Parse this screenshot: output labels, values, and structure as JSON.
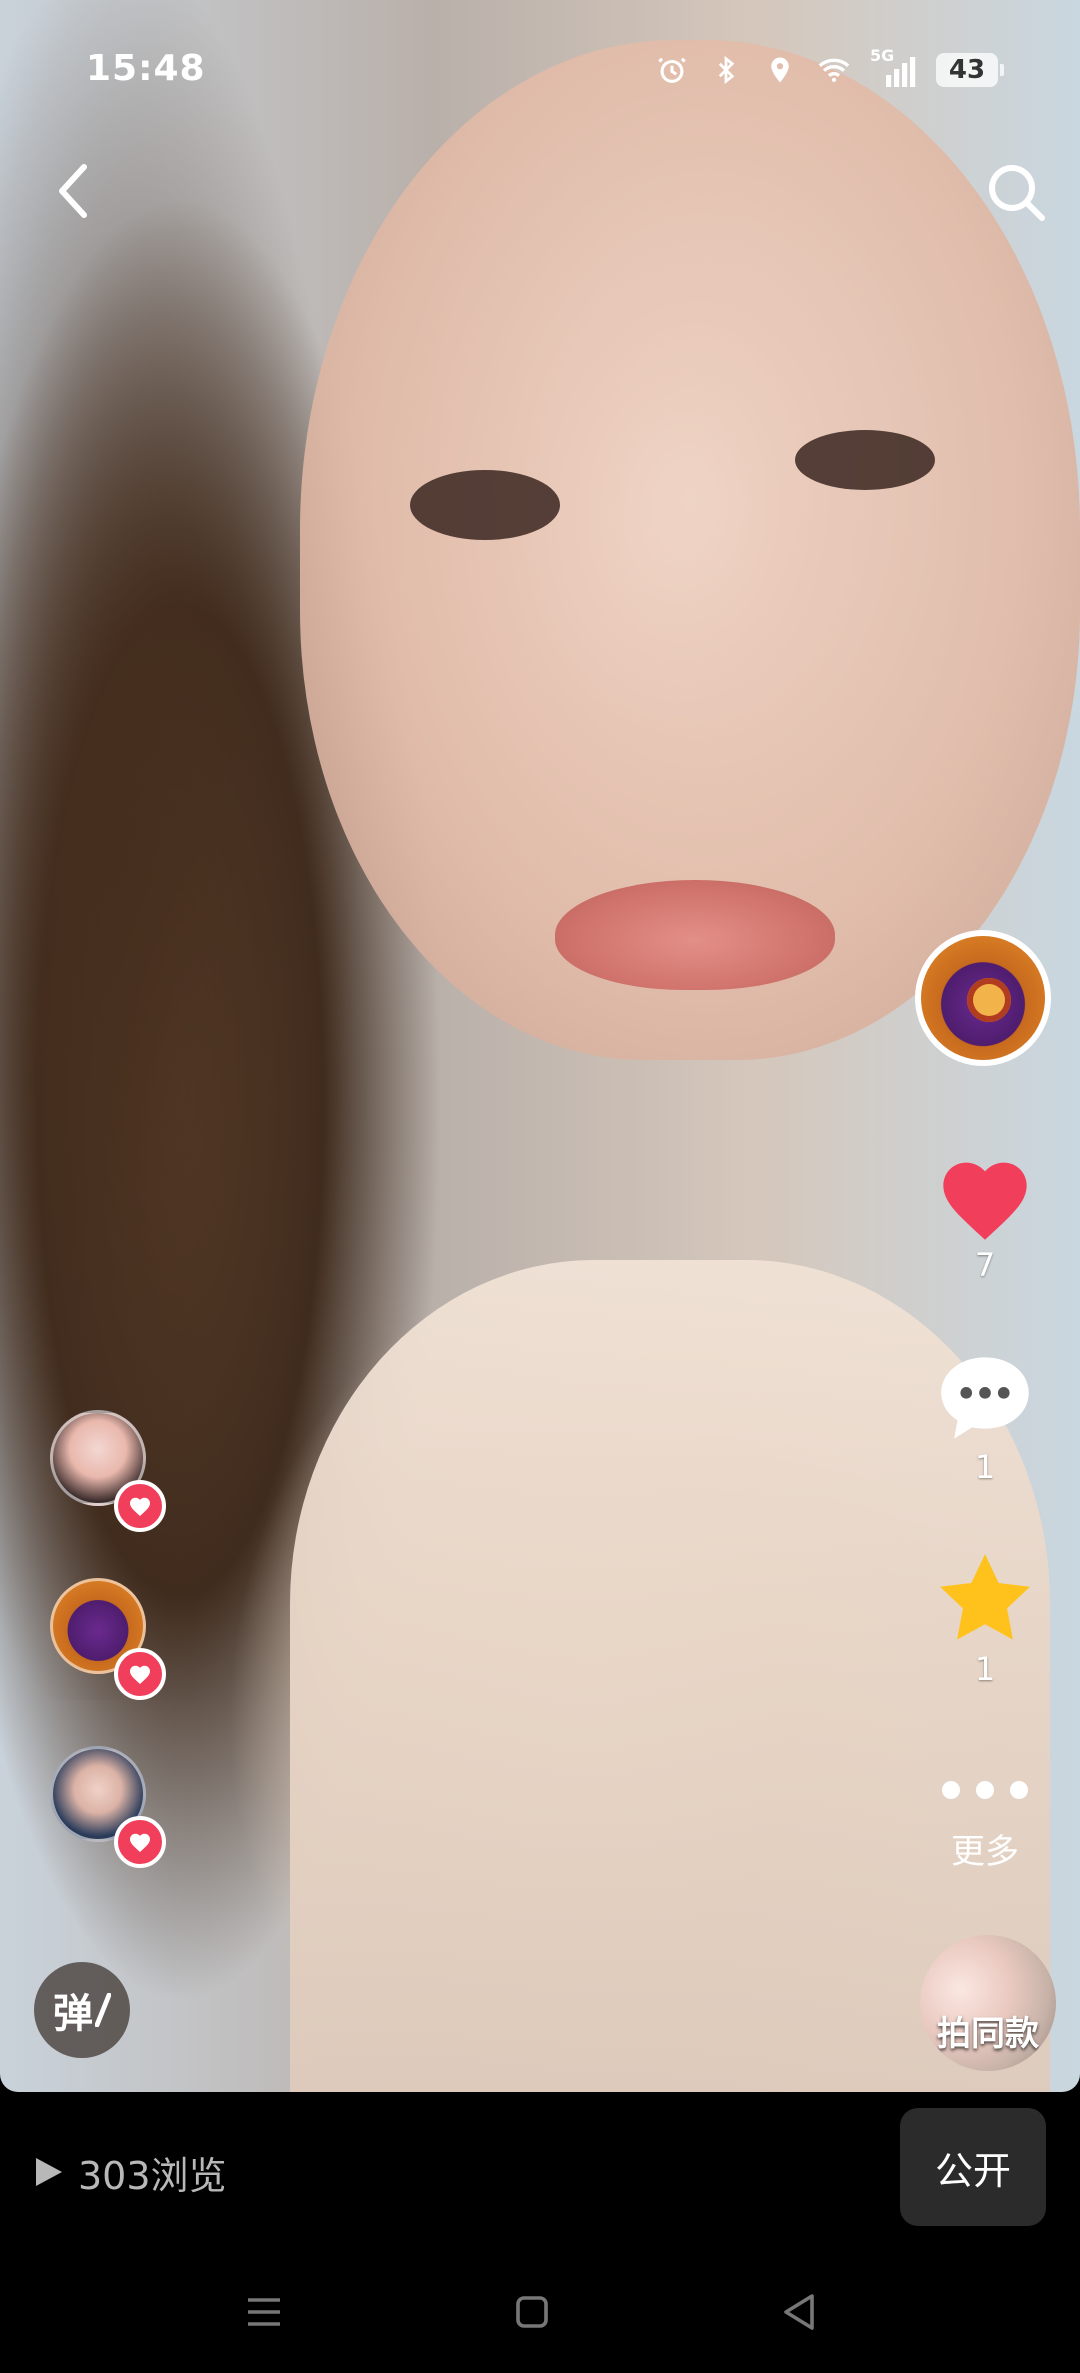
{
  "status_bar": {
    "time": "15:48",
    "network": "5G",
    "battery": "43"
  },
  "video": {
    "like_count": "7",
    "comment_count": "1",
    "favorite_count": "1",
    "more_label": "更多",
    "shoot_same_label": "拍同款",
    "danmu_label": "弹"
  },
  "bottom": {
    "views": "303浏览",
    "public_label": "公开"
  },
  "colors": {
    "like_red": "#f03e5b",
    "star_yellow": "#ffc21c",
    "background": "#000000"
  },
  "icons": [
    "back-icon",
    "search-icon",
    "heart-icon",
    "comment-icon",
    "star-icon",
    "more-dots-icon",
    "play-icon",
    "menu-icon",
    "home-square-icon",
    "back-triangle-icon",
    "alarm-icon",
    "bluetooth-icon",
    "location-icon",
    "wifi-icon",
    "signal-icon"
  ]
}
